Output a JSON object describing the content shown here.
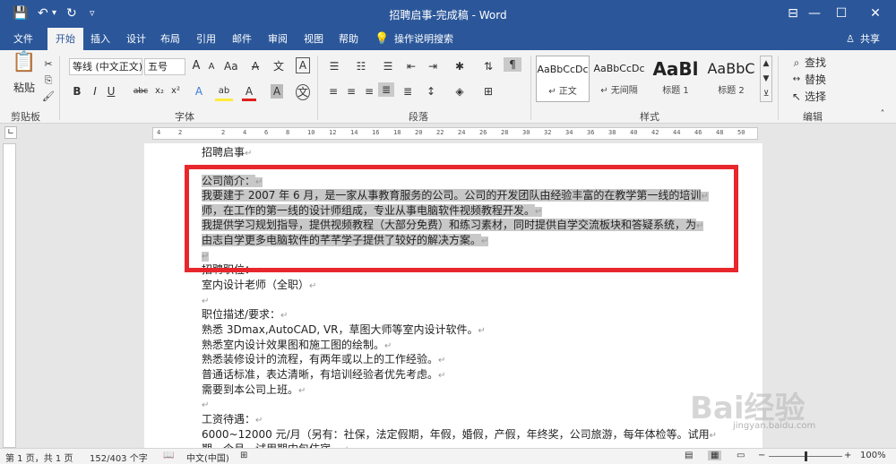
{
  "window": {
    "title": "招聘启事-完成稿  -  Word",
    "minimize": "—",
    "restore": "☐",
    "close": "✕",
    "ribbon_options": "⊟"
  },
  "quick_access": {
    "save": "💾",
    "undo": "↶",
    "undo_drop": "▾",
    "redo": "↻",
    "customize": "▿"
  },
  "tabs": [
    "文件",
    "开始",
    "插入",
    "设计",
    "布局",
    "引用",
    "邮件",
    "审阅",
    "视图",
    "帮助"
  ],
  "tell_me": "操作说明搜索",
  "share": "共享",
  "ribbon": {
    "clipboard": {
      "paste": "粘贴",
      "label": "剪贴板"
    },
    "font": {
      "name": "等线 (中文正文)",
      "size": "五号",
      "label": "字体",
      "grow": "A",
      "shrink": "A",
      "clear": "A",
      "bold": "B",
      "italic": "I",
      "underline": "U",
      "strike": "abc",
      "sub": "x₂",
      "sup": "x²",
      "effects": "A",
      "highlight": "ab",
      "color": "A",
      "shade": "A",
      "enclose": "A",
      "font_glyph": "文"
    },
    "paragraph": {
      "label": "段落"
    },
    "styles": {
      "label": "样式",
      "items": [
        {
          "preview": "AaBbCcDc",
          "name": "↵ 正文"
        },
        {
          "preview": "AaBbCcDc",
          "name": "↵ 无间隔"
        },
        {
          "preview": "AaBl",
          "name": "标题 1"
        },
        {
          "preview": "AaBbC",
          "name": "标题 2"
        }
      ]
    },
    "editing": {
      "find": "查找",
      "replace": "替换",
      "select": "选择",
      "label": "编辑"
    }
  },
  "ruler": {
    "hticks": [
      "4",
      "2",
      "",
      "2",
      "4",
      "6",
      "8",
      "10",
      "12",
      "14",
      "16",
      "18",
      "20",
      "22",
      "24",
      "26",
      "28",
      "30",
      "32",
      "34",
      "36",
      "38",
      "40",
      "42",
      "44",
      "46",
      "48",
      "50"
    ]
  },
  "document": {
    "lines": [
      {
        "text": "招聘启事",
        "hl": false
      },
      {
        "text": "公司简介：",
        "hl": true
      },
      {
        "text": "我要建于 2007 年 6 月，是一家从事教育服务的公司。公司的开发团队由经验丰富的在教学第一线的培训",
        "hl": true
      },
      {
        "text": "师，在工作的第一线的设计师组成，专业从事电脑软件视频教程开发。",
        "hl": true
      },
      {
        "text": "我提供学习规划指导，提供视频教程（大部分免费）和练习素材，同时提供自学交流板块和答疑系统，为",
        "hl": true
      },
      {
        "text": "由志自学更多电脑软件的芊芊学子提供了较好的解决方案。",
        "hl": true
      },
      {
        "text": "",
        "hl": true
      },
      {
        "text": "招聘职位：",
        "hl": false
      },
      {
        "text": "室内设计老师（全职）",
        "hl": false
      },
      {
        "text": "",
        "hl": false
      },
      {
        "text": "职位描述/要求：",
        "hl": false
      },
      {
        "text": "熟悉 3Dmax,AutoCAD, VR，草图大师等室内设计软件。",
        "hl": false
      },
      {
        "text": "熟悉室内设计效果图和施工图的绘制。",
        "hl": false
      },
      {
        "text": "熟悉装修设计的流程，有两年或以上的工作经验。",
        "hl": false
      },
      {
        "text": "普通话标准，表达清晰，有培训经验者优先考虑。",
        "hl": false
      },
      {
        "text": "需要到本公司上班。",
        "hl": false
      },
      {
        "text": "",
        "hl": false
      },
      {
        "text": "工资待遇：",
        "hl": false
      },
      {
        "text": "6000~12000 元/月（另有：社保，法定假期，年假，婚假，产假，年终奖，公司旅游，每年体检等。试用",
        "hl": false
      },
      {
        "text": "期一个月，试用期内包住宿。",
        "hl": false
      }
    ],
    "para_mark": "↵"
  },
  "status": {
    "page": "第 1 页，共 1 页",
    "words": "152/403 个字",
    "language": "中文(中国)",
    "zoom": "100%",
    "zoom_level": 1.0
  },
  "watermark": {
    "text": "Bai经验",
    "url": "jingyan.baidu.com"
  },
  "colors": {
    "accent": "#2b579a",
    "highlight_box": "#e8272d",
    "selection": "#c8c8c8"
  }
}
